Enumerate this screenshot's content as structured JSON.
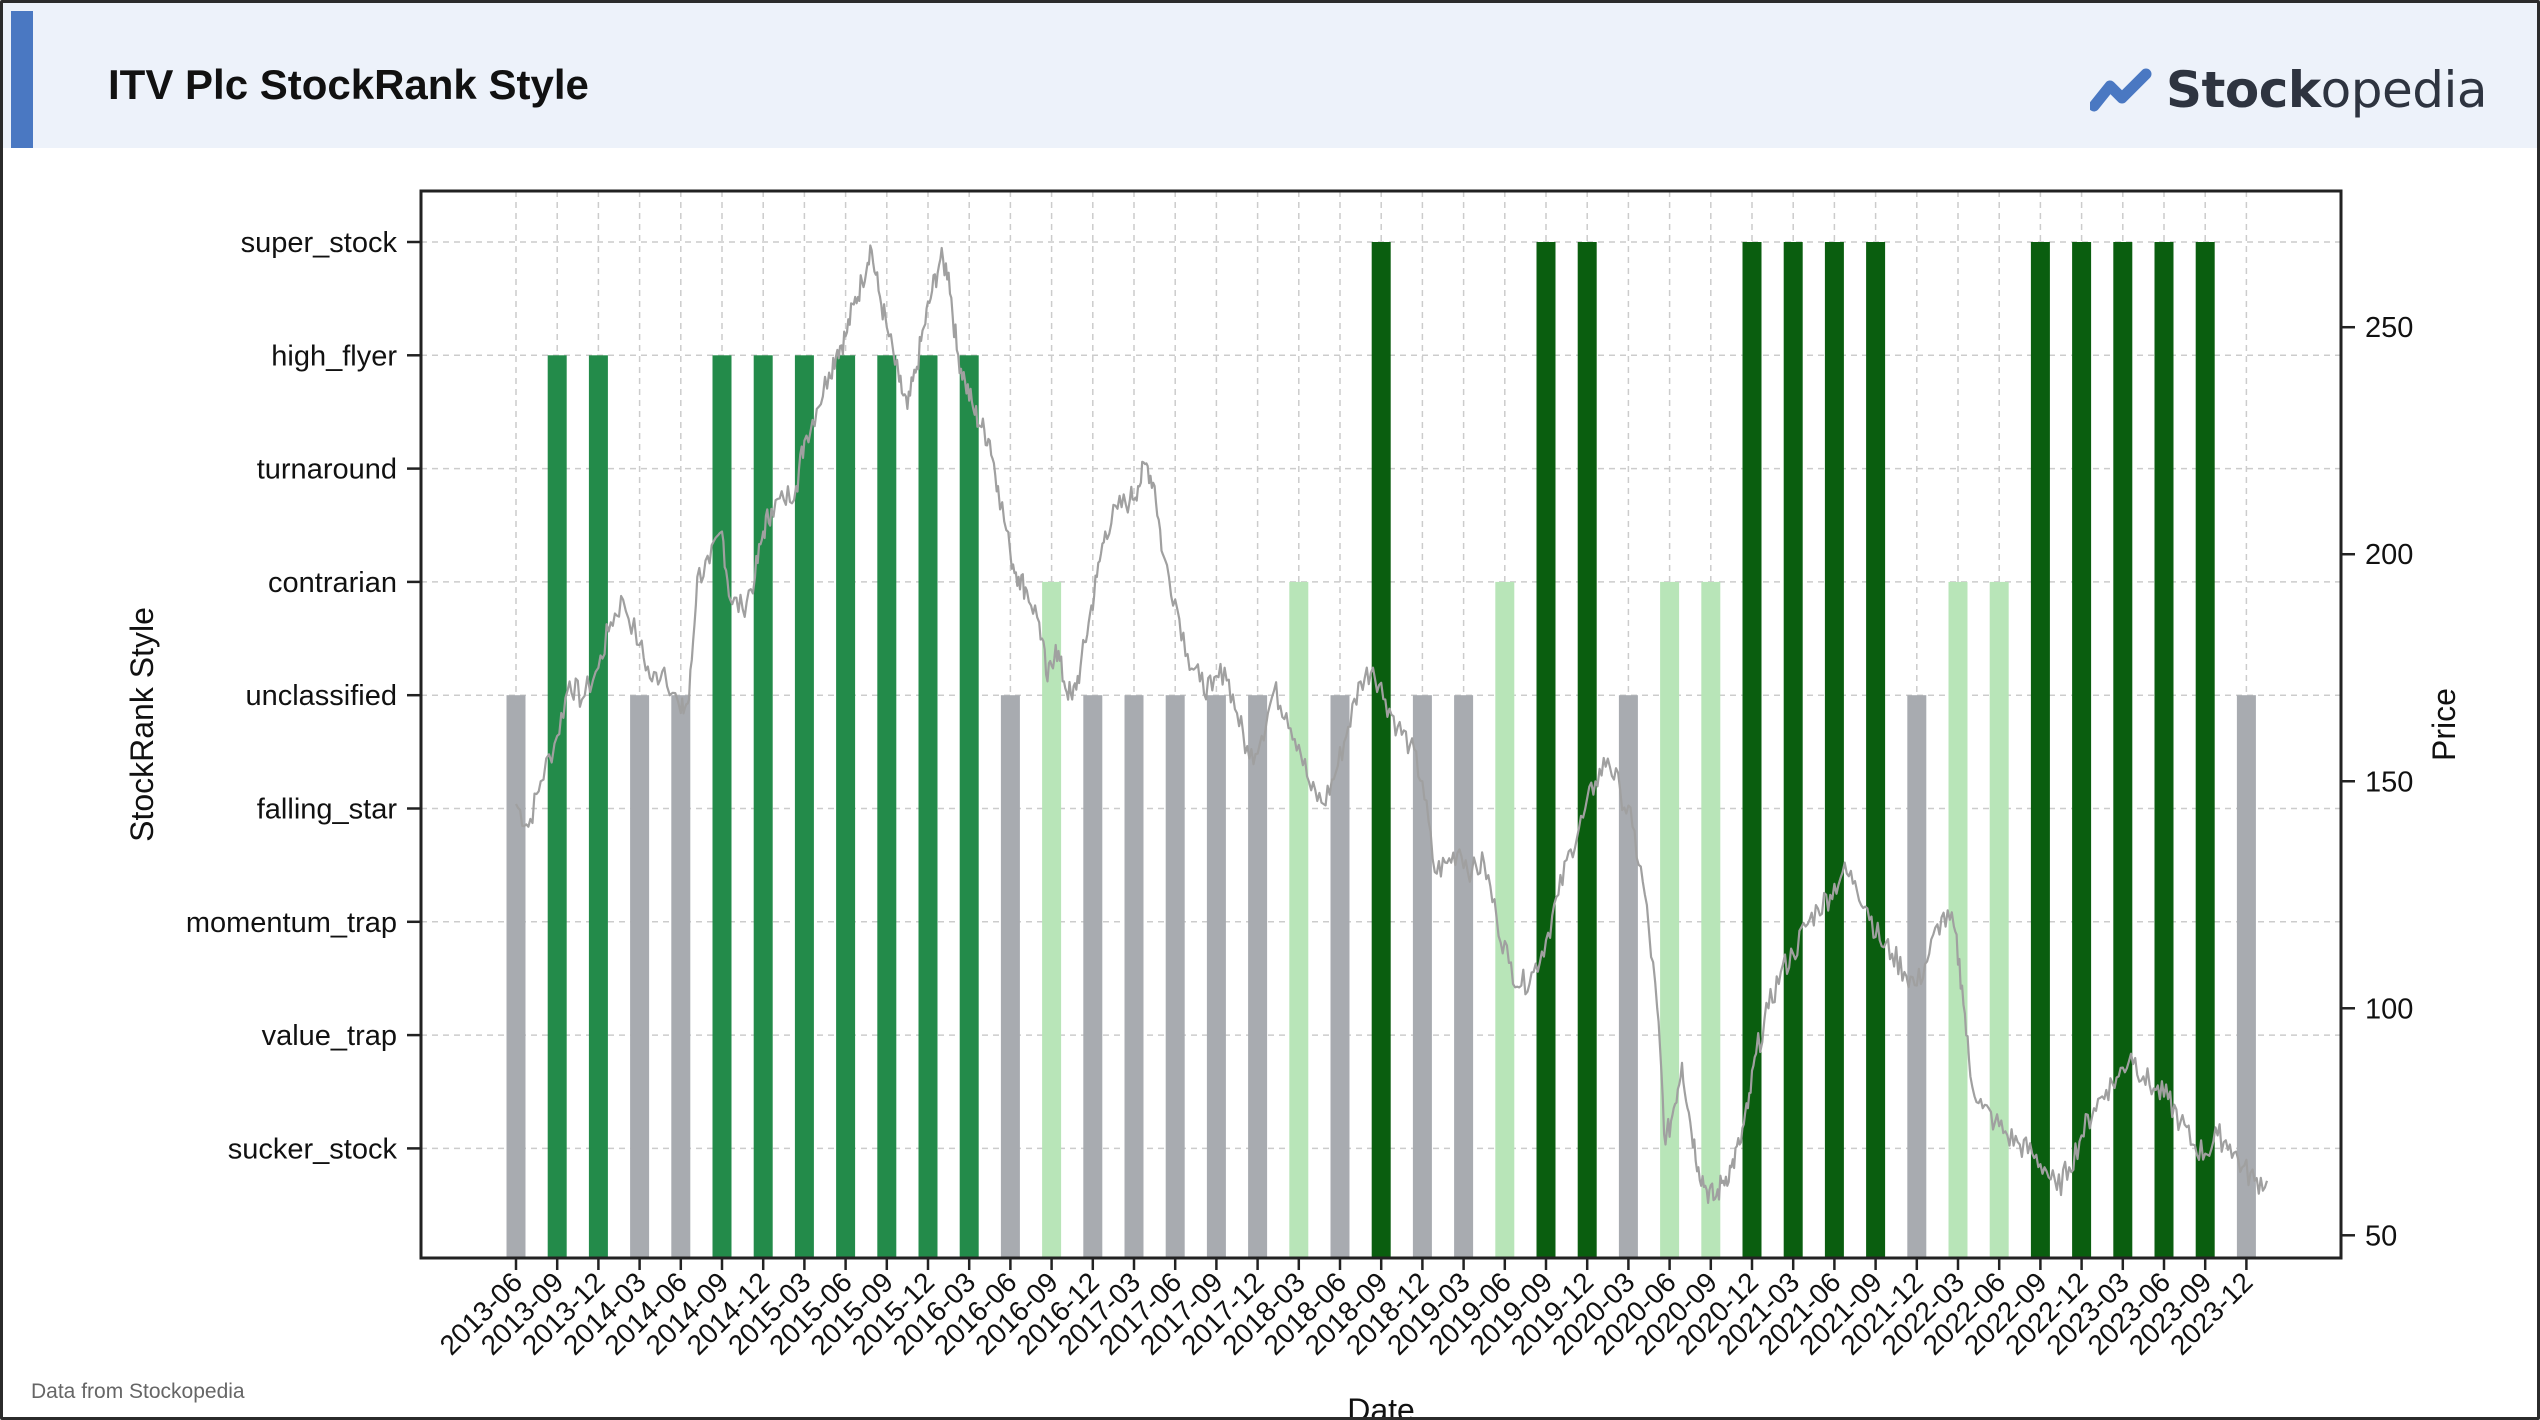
{
  "header": {
    "title": "ITV Plc StockRank Style",
    "logo_bold": "Stock",
    "logo_light": "opedia",
    "accent_color": "#4a78c2"
  },
  "footer": {
    "note": "Data from Stockopedia"
  },
  "chart_data": {
    "type": "bar",
    "xlabel": "Date",
    "ylabel_left": "StockRank Style",
    "ylabel_right": "Price",
    "styles": [
      "sucker_stock",
      "value_trap",
      "momentum_trap",
      "falling_star",
      "unclassified",
      "contrarian",
      "turnaround",
      "high_flyer",
      "super_stock"
    ],
    "style_colors": {
      "unclassified": "#a8abb0",
      "high_flyer": "#238b4a",
      "super_stock": "#0a5e0f",
      "contrarian": "#b8e5b8"
    },
    "categories": [
      "2013-06",
      "2013-09",
      "2013-12",
      "2014-03",
      "2014-06",
      "2014-09",
      "2014-12",
      "2015-03",
      "2015-06",
      "2015-09",
      "2015-12",
      "2016-03",
      "2016-06",
      "2016-09",
      "2016-12",
      "2017-03",
      "2017-06",
      "2017-09",
      "2017-12",
      "2018-03",
      "2018-06",
      "2018-09",
      "2018-12",
      "2019-03",
      "2019-06",
      "2019-09",
      "2019-12",
      "2020-03",
      "2020-06",
      "2020-09",
      "2020-12",
      "2021-03",
      "2021-06",
      "2021-09",
      "2021-12",
      "2022-03",
      "2022-06",
      "2022-09",
      "2022-12",
      "2023-03",
      "2023-06",
      "2023-09",
      "2023-12"
    ],
    "values": [
      "unclassified",
      "high_flyer",
      "high_flyer",
      "unclassified",
      "unclassified",
      "high_flyer",
      "high_flyer",
      "high_flyer",
      "high_flyer",
      "high_flyer",
      "high_flyer",
      "high_flyer",
      "unclassified",
      "contrarian",
      "unclassified",
      "unclassified",
      "unclassified",
      "unclassified",
      "unclassified",
      "contrarian",
      "unclassified",
      "super_stock",
      "unclassified",
      "unclassified",
      "contrarian",
      "super_stock",
      "super_stock",
      "unclassified",
      "contrarian",
      "contrarian",
      "super_stock",
      "super_stock",
      "super_stock",
      "super_stock",
      "unclassified",
      "contrarian",
      "contrarian",
      "super_stock",
      "super_stock",
      "super_stock",
      "super_stock",
      "super_stock",
      "unclassified"
    ],
    "price_series": {
      "name": "Price",
      "color": "#a0a0a0",
      "ylim": [
        45,
        280
      ],
      "yticks": [
        50,
        100,
        150,
        200,
        250
      ],
      "points": [
        [
          0,
          145
        ],
        [
          0.3,
          140
        ],
        [
          0.6,
          150
        ],
        [
          1.0,
          160
        ],
        [
          1.3,
          172
        ],
        [
          1.6,
          168
        ],
        [
          2.0,
          175
        ],
        [
          2.3,
          185
        ],
        [
          2.6,
          190
        ],
        [
          3.0,
          180
        ],
        [
          3.3,
          172
        ],
        [
          3.6,
          175
        ],
        [
          4.0,
          165
        ],
        [
          4.2,
          168
        ],
        [
          4.4,
          195
        ],
        [
          4.7,
          198
        ],
        [
          5.0,
          205
        ],
        [
          5.2,
          190
        ],
        [
          5.5,
          188
        ],
        [
          5.8,
          195
        ],
        [
          6.0,
          205
        ],
        [
          6.2,
          210
        ],
        [
          6.5,
          212
        ],
        [
          6.8,
          215
        ],
        [
          7.0,
          225
        ],
        [
          7.3,
          232
        ],
        [
          7.6,
          240
        ],
        [
          7.8,
          245
        ],
        [
          8.0,
          248
        ],
        [
          8.2,
          255
        ],
        [
          8.4,
          260
        ],
        [
          8.6,
          268
        ],
        [
          8.8,
          258
        ],
        [
          9.0,
          250
        ],
        [
          9.3,
          238
        ],
        [
          9.5,
          232
        ],
        [
          9.7,
          240
        ],
        [
          9.9,
          250
        ],
        [
          10.1,
          258
        ],
        [
          10.3,
          265
        ],
        [
          10.5,
          262
        ],
        [
          10.7,
          245
        ],
        [
          10.9,
          238
        ],
        [
          11.1,
          232
        ],
        [
          11.3,
          228
        ],
        [
          11.5,
          225
        ],
        [
          11.7,
          215
        ],
        [
          12.0,
          200
        ],
        [
          12.2,
          195
        ],
        [
          12.4,
          192
        ],
        [
          12.7,
          185
        ],
        [
          12.9,
          172
        ],
        [
          13.1,
          180
        ],
        [
          13.3,
          172
        ],
        [
          13.5,
          168
        ],
        [
          13.7,
          175
        ],
        [
          13.9,
          185
        ],
        [
          14.1,
          195
        ],
        [
          14.3,
          205
        ],
        [
          14.6,
          210
        ],
        [
          14.9,
          212
        ],
        [
          15.1,
          215
        ],
        [
          15.3,
          220
        ],
        [
          15.5,
          215
        ],
        [
          15.7,
          200
        ],
        [
          16.0,
          190
        ],
        [
          16.3,
          178
        ],
        [
          16.6,
          172
        ],
        [
          16.9,
          170
        ],
        [
          17.2,
          175
        ],
        [
          17.5,
          165
        ],
        [
          17.8,
          155
        ],
        [
          18.1,
          160
        ],
        [
          18.4,
          170
        ],
        [
          18.7,
          165
        ],
        [
          19.0,
          158
        ],
        [
          19.3,
          148
        ],
        [
          19.6,
          145
        ],
        [
          19.9,
          152
        ],
        [
          20.2,
          162
        ],
        [
          20.5,
          172
        ],
        [
          20.8,
          175
        ],
        [
          21.1,
          168
        ],
        [
          21.4,
          162
        ],
        [
          21.7,
          158
        ],
        [
          22.0,
          150
        ],
        [
          22.3,
          130
        ],
        [
          22.6,
          132
        ],
        [
          22.9,
          135
        ],
        [
          23.2,
          130
        ],
        [
          23.5,
          132
        ],
        [
          23.8,
          120
        ],
        [
          24.1,
          110
        ],
        [
          24.4,
          105
        ],
        [
          24.7,
          108
        ],
        [
          25.0,
          115
        ],
        [
          25.3,
          125
        ],
        [
          25.6,
          135
        ],
        [
          25.9,
          142
        ],
        [
          26.2,
          150
        ],
        [
          26.5,
          155
        ],
        [
          26.8,
          148
        ],
        [
          27.1,
          140
        ],
        [
          27.4,
          125
        ],
        [
          27.7,
          100
        ],
        [
          27.9,
          70
        ],
        [
          28.1,
          78
        ],
        [
          28.3,
          88
        ],
        [
          28.5,
          75
        ],
        [
          28.7,
          65
        ],
        [
          28.9,
          60
        ],
        [
          29.1,
          58
        ],
        [
          29.3,
          62
        ],
        [
          29.5,
          65
        ],
        [
          29.7,
          70
        ],
        [
          29.9,
          78
        ],
        [
          30.1,
          90
        ],
        [
          30.4,
          100
        ],
        [
          30.7,
          108
        ],
        [
          31.0,
          112
        ],
        [
          31.3,
          118
        ],
        [
          31.6,
          122
        ],
        [
          31.9,
          125
        ],
        [
          32.2,
          130
        ],
        [
          32.5,
          128
        ],
        [
          32.8,
          122
        ],
        [
          33.1,
          115
        ],
        [
          33.4,
          112
        ],
        [
          33.7,
          108
        ],
        [
          34.0,
          105
        ],
        [
          34.3,
          112
        ],
        [
          34.6,
          120
        ],
        [
          34.9,
          118
        ],
        [
          35.1,
          105
        ],
        [
          35.3,
          85
        ],
        [
          35.6,
          78
        ],
        [
          35.9,
          75
        ],
        [
          36.2,
          72
        ],
        [
          36.5,
          70
        ],
        [
          36.8,
          68
        ],
        [
          37.1,
          65
        ],
        [
          37.4,
          60
        ],
        [
          37.7,
          65
        ],
        [
          38.0,
          72
        ],
        [
          38.3,
          78
        ],
        [
          38.6,
          82
        ],
        [
          38.9,
          85
        ],
        [
          39.2,
          90
        ],
        [
          39.5,
          85
        ],
        [
          39.8,
          82
        ],
        [
          40.1,
          80
        ],
        [
          40.4,
          75
        ],
        [
          40.7,
          70
        ],
        [
          41.0,
          68
        ],
        [
          41.3,
          72
        ],
        [
          41.6,
          70
        ],
        [
          41.9,
          65
        ],
        [
          42.2,
          62
        ],
        [
          42.5,
          62
        ]
      ]
    }
  }
}
